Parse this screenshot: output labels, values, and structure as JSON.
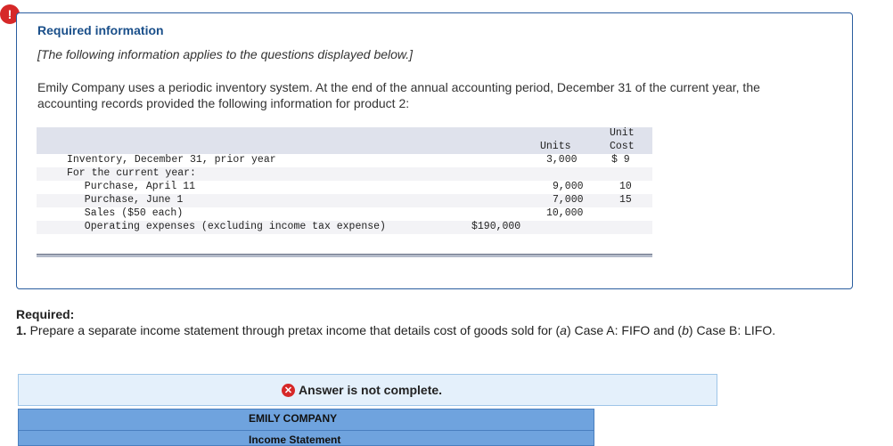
{
  "alert": {
    "symbol": "!"
  },
  "info": {
    "title": "Required information",
    "note": "[The following information applies to the questions displayed below.]",
    "paragraph": "Emily Company uses a periodic inventory system. At the end of the annual accounting period, December 31 of the current year, the accounting records provided the following information for product 2:"
  },
  "table": {
    "header": {
      "units": "Units",
      "unit_top": "Unit",
      "unit_bottom": "Cost"
    },
    "rows": [
      {
        "label": "Inventory, December 31, prior year",
        "amount": "",
        "units": "3,000",
        "cost": "$ 9"
      },
      {
        "label": "For the current year:",
        "amount": "",
        "units": "",
        "cost": ""
      },
      {
        "label": "  Purchase, April 11",
        "amount": "",
        "units": "9,000",
        "cost": "10"
      },
      {
        "label": "  Purchase, June 1",
        "amount": "",
        "units": "7,000",
        "cost": "15"
      },
      {
        "label": "  Sales ($50 each)",
        "amount": "",
        "units": "10,000",
        "cost": ""
      },
      {
        "label": "  Operating expenses (excluding income tax expense)",
        "amount": "$190,000",
        "units": "",
        "cost": ""
      }
    ]
  },
  "required": {
    "heading": "Required:",
    "text_num": "1.",
    "text_part1": " Prepare a separate income statement through pretax income that details cost of goods sold for (",
    "text_a": "a",
    "text_part2": ") Case A: FIFO and (",
    "text_b": "b",
    "text_part3": ") Case B: LIFO."
  },
  "answer": {
    "status": "Answer is not complete.",
    "icon": "x-circle-icon"
  },
  "statement": {
    "company": "EMILY COMPANY",
    "title": "Income Statement"
  },
  "colors": {
    "accent": "#1a4f8a",
    "error": "#d62828",
    "banner": "#e4f0fb",
    "header": "#6fa3de"
  }
}
